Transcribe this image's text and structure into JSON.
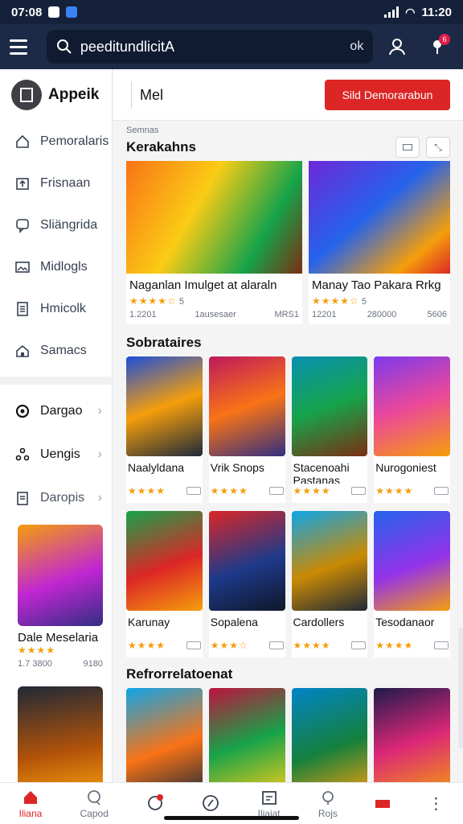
{
  "status": {
    "time_left": "07:08",
    "time_right": "11:20"
  },
  "search": {
    "value": "peeditundlicitA",
    "ok_label": "ok",
    "badge": "6"
  },
  "sidebar": {
    "brand": "Appeik",
    "items": [
      {
        "label": "Pemoralaris",
        "icon": "home-outline-icon"
      },
      {
        "label": "Frisnaan",
        "icon": "upload-icon"
      },
      {
        "label": "Sliängrida",
        "icon": "chat-icon"
      },
      {
        "label": "Midlogls",
        "icon": "image-icon"
      },
      {
        "label": "Hmicolk",
        "icon": "document-icon"
      },
      {
        "label": "Samacs",
        "icon": "house-icon"
      }
    ],
    "groups": [
      {
        "label": "Dargao",
        "icon": "circle-icon"
      },
      {
        "label": "Uengis",
        "icon": "share-icon"
      },
      {
        "label": "Daropis",
        "icon": "file-icon"
      }
    ],
    "cards": [
      {
        "title": "Dale Meselaria",
        "stars": "★★★★",
        "meta_left": "1.7 3800",
        "meta_right": "9180"
      },
      {
        "title": "",
        "stars": "",
        "meta_left": "",
        "meta_right": ""
      }
    ]
  },
  "header": {
    "title": "Mel",
    "cta": "Sild Demorarabun"
  },
  "section1": {
    "caption": "Semnas",
    "title": "Kerakahns",
    "cards": [
      {
        "title": "Naganlan Imulget at alaraln",
        "stars": "★★★★☆",
        "rating": "5",
        "meta_left": "1.2201",
        "meta_mid": "1ausesaer",
        "meta_right": "MRS1"
      },
      {
        "title": "Manay Tao Pakara Rrkg",
        "stars": "★★★★☆",
        "rating": "5",
        "meta_left": "12201",
        "meta_mid": "280000",
        "meta_right": "5606"
      }
    ]
  },
  "section2": {
    "title": "Sobrataires",
    "row1": [
      {
        "title": "Naalyldana",
        "stars": "★★★★"
      },
      {
        "title": "Vrik Snops",
        "stars": "★★★★"
      },
      {
        "title": "Stacenoahi Pastanas",
        "stars": "★★★★"
      },
      {
        "title": "Nurogoniest",
        "stars": "★★★★"
      }
    ],
    "row2": [
      {
        "title": "Karunay",
        "stars": "★★★★"
      },
      {
        "title": "Sopalena",
        "stars": "★★★☆"
      },
      {
        "title": "Cardollers",
        "stars": "★★★★"
      },
      {
        "title": "Tesodanaor",
        "stars": "★★★★"
      }
    ]
  },
  "section3": {
    "title": "Refrorrelatoenat"
  },
  "bottom_nav": [
    {
      "label": "Iliana",
      "icon": "home-icon",
      "active": true
    },
    {
      "label": "Capod",
      "icon": "chat-bubble-icon"
    },
    {
      "label": "",
      "icon": "notification-icon"
    },
    {
      "label": "",
      "icon": "compass-icon"
    },
    {
      "label": "Iliaiat",
      "icon": "calendar-icon"
    },
    {
      "label": "Rojs",
      "icon": "support-icon"
    }
  ]
}
